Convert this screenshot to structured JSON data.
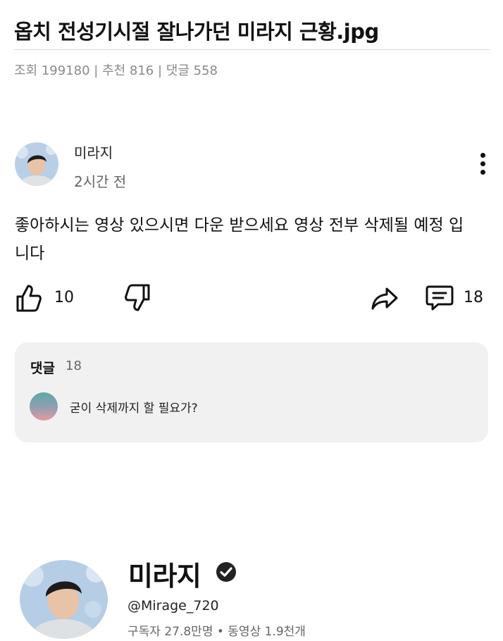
{
  "post": {
    "title": "옵치 전성기시절 잘나가던 미라지 근황.jpg",
    "meta": "조회 199180 | 추천 816 | 댓글 558"
  },
  "community_post": {
    "channel_name": "미라지",
    "time": "2시간 전",
    "body": "좋아하시는 영상 있으시면 다운 받으세요 영상 전부 삭제될 예정 입니다",
    "like_count": "10",
    "comment_count": "18",
    "icons": {
      "like": "thumbs-up-icon",
      "dislike": "thumbs-down-icon",
      "share": "share-icon",
      "comment": "comment-icon",
      "more": "more-vert-icon"
    }
  },
  "comments": {
    "label": "댓글",
    "count": "18",
    "top_comment": "굳이 삭제까지 할 필요가?"
  },
  "channel": {
    "name": "미라지",
    "handle": "@Mirage_720",
    "stats": "구독자 27.8만명 • 동영상 1.9천개"
  },
  "colors": {
    "card_bg": "#f1f1f1",
    "meta_gray": "#8a8a8a",
    "text": "#111111"
  }
}
